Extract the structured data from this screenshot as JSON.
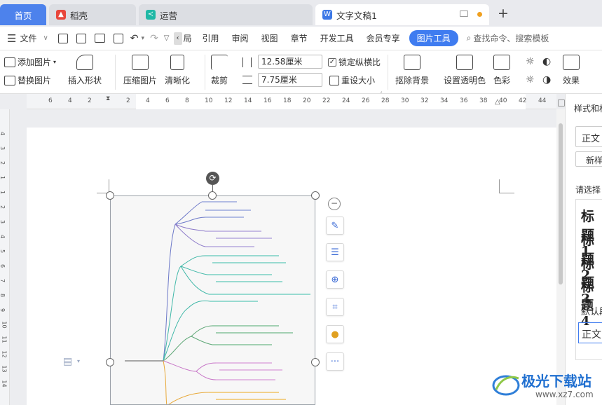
{
  "tabs": {
    "home": "首页",
    "daoke": "稻壳",
    "yunying": "运营",
    "doc": "文字文稿1",
    "add": "+"
  },
  "menubar": {
    "file": "文件",
    "items": [
      "引用",
      "审阅",
      "视图",
      "章节",
      "开发工具",
      "会员专享"
    ],
    "partial_item": "局",
    "active_tool": "图片工具",
    "search_placeholder": "查找命令、搜索模板"
  },
  "ribbon": {
    "add_image": "添加图片",
    "replace_image": "替换图片",
    "insert_shape": "插入形状",
    "compress": "压缩图片",
    "sharpen": "清晰化",
    "crop": "裁剪",
    "width": "12.58厘米",
    "height": "7.75厘米",
    "lock_ratio": "锁定纵横比",
    "reset_size": "重设大小",
    "remove_bg": "抠除背景",
    "set_transparent": "设置透明色",
    "color": "色彩",
    "effects": "效果"
  },
  "ruler": {
    "left_numbers": [
      "6",
      "4",
      "2"
    ],
    "right_numbers": [
      "2",
      "4",
      "6",
      "8",
      "10",
      "12",
      "14",
      "16",
      "18",
      "20",
      "22",
      "24",
      "26",
      "28",
      "30",
      "32",
      "34",
      "36",
      "38",
      "40",
      "42",
      "44"
    ],
    "vertical_numbers": [
      "4",
      "3",
      "2",
      "1",
      "1",
      "2",
      "3",
      "4",
      "5",
      "6",
      "7",
      "8",
      "9",
      "10",
      "11",
      "12",
      "13",
      "14"
    ]
  },
  "right_panel": {
    "title": "样式和格式",
    "current_style": "正文",
    "new_style": "新样式",
    "choose": "请选择",
    "headings": [
      "标题1",
      "标题2",
      "标题3",
      "标题4"
    ],
    "default": "默认段落字体",
    "body": "正文"
  },
  "watermark": {
    "name": "极光下载站",
    "url": "www.xz7.com"
  },
  "colors": {
    "accent": "#4d82ec",
    "active_tab_pill": "#3f7cf0"
  }
}
